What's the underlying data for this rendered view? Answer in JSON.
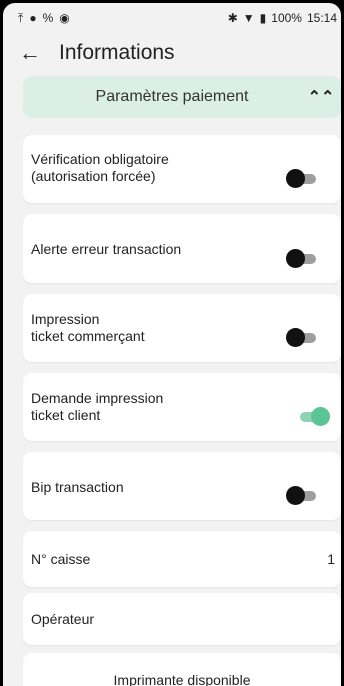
{
  "statusbar": {
    "left_icons": [
      "upload-icon",
      "app-icon",
      "link-icon",
      "shield-icon"
    ],
    "bluetooth": "✱",
    "wifi": "▼",
    "battery_icon": "▮",
    "battery": "100%",
    "time": "15:14"
  },
  "appbar": {
    "back": "←",
    "title": "Informations"
  },
  "section": {
    "title": "Paramètres paiement",
    "chevron": "⌃"
  },
  "settings": [
    {
      "label": "Vérification obligatoire\n(autorisation forcée)",
      "enabled": false
    },
    {
      "label": "Alerte erreur transaction",
      "enabled": false
    },
    {
      "label": "Impression\nticket commerçant",
      "enabled": false
    },
    {
      "label": "Demande impression\nticket client",
      "enabled": true
    },
    {
      "label": "Bip transaction",
      "enabled": false
    }
  ],
  "caisse": {
    "label": "N° caisse",
    "value": "1"
  },
  "operateur": {
    "label": "Opérateur"
  },
  "imprimante": {
    "label": "Imprimante disponible"
  },
  "colors": {
    "accent": "#5cc595",
    "header_bg": "#dcefe7"
  }
}
